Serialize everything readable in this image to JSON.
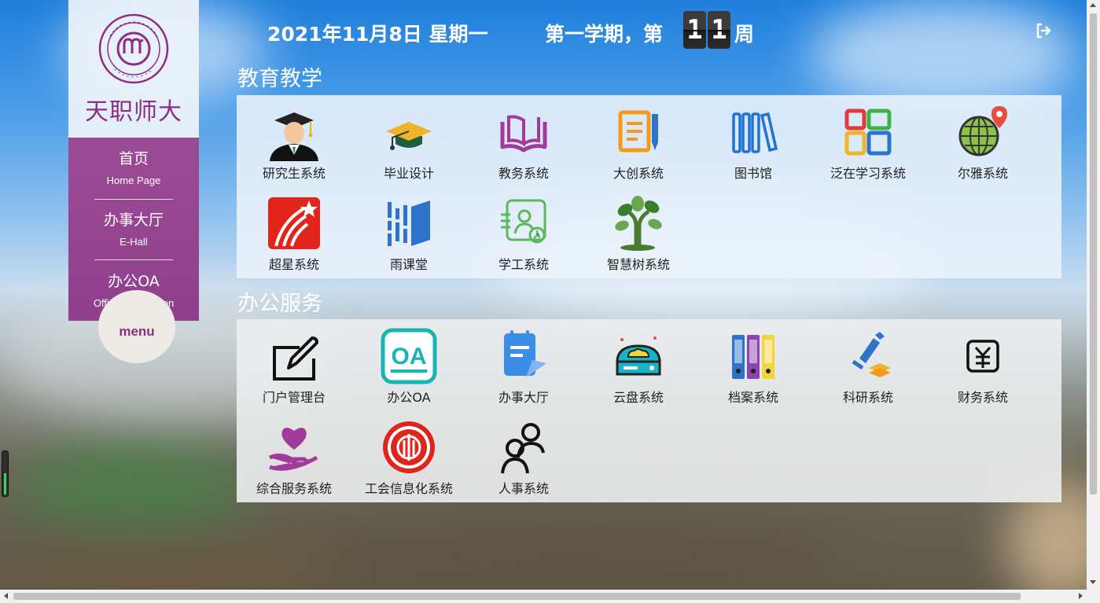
{
  "header": {
    "date": "2021年11月8日 星期一",
    "term_prefix": "第一学期，第",
    "week_digits": [
      "1",
      "1"
    ],
    "week_suffix": "周"
  },
  "brand": {
    "school_name": "天职师大",
    "seal_color": "#8e2e82"
  },
  "side_nav": {
    "items": [
      {
        "cn": "首页",
        "en": "Home Page"
      },
      {
        "cn": "办事大厅",
        "en": "E-Hall"
      },
      {
        "cn": "办公OA",
        "en": "Office Automation"
      }
    ],
    "menu_label": "menu",
    "accent_color": "#8f3f8c"
  },
  "sections": [
    {
      "title": "教育教学",
      "tiles": [
        {
          "label": "研究生系统",
          "icon": "graduate-student-icon"
        },
        {
          "label": "毕业设计",
          "icon": "graduation-cap-icon"
        },
        {
          "label": "教务系统",
          "icon": "open-book-icon"
        },
        {
          "label": "大创系统",
          "icon": "notepad-pencil-icon"
        },
        {
          "label": "图书馆",
          "icon": "bookshelf-icon"
        },
        {
          "label": "泛在学习系统",
          "icon": "colorful-grid-icon"
        },
        {
          "label": "尔雅系统",
          "icon": "globe-pin-icon"
        },
        {
          "label": "超星系统",
          "icon": "chaoxing-star-icon"
        },
        {
          "label": "雨课堂",
          "icon": "rain-classroom-icon"
        },
        {
          "label": "学工系统",
          "icon": "student-card-icon"
        },
        {
          "label": "智慧树系统",
          "icon": "wisdom-tree-icon"
        }
      ]
    },
    {
      "title": "办公服务",
      "tiles": [
        {
          "label": "门户管理台",
          "icon": "edit-square-icon"
        },
        {
          "label": "办公OA",
          "icon": "oa-badge-icon"
        },
        {
          "label": "办事大厅",
          "icon": "clipboard-send-icon"
        },
        {
          "label": "云盘系统",
          "icon": "cloud-disk-icon"
        },
        {
          "label": "档案系统",
          "icon": "binders-icon"
        },
        {
          "label": "科研系统",
          "icon": "microscope-icon"
        },
        {
          "label": "财务系统",
          "icon": "yuan-icon"
        },
        {
          "label": "综合服务系统",
          "icon": "heart-hand-icon"
        },
        {
          "label": "工会信息化系统",
          "icon": "union-emblem-icon"
        },
        {
          "label": "人事系统",
          "icon": "people-icon"
        }
      ]
    }
  ]
}
